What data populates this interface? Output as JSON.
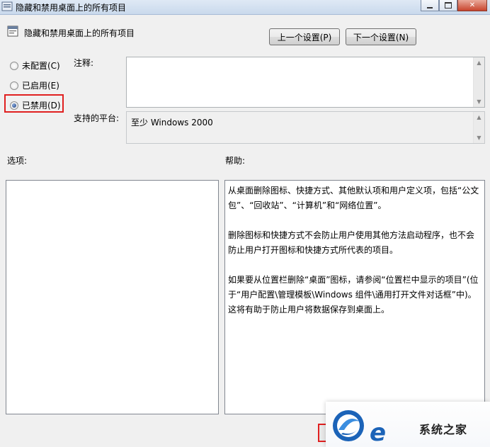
{
  "window": {
    "title": "隐藏和禁用桌面上的所有项目"
  },
  "header": {
    "policy_name": "隐藏和禁用桌面上的所有项目",
    "prev_button": "上一个设置(P)",
    "next_button": "下一个设置(N)"
  },
  "state": {
    "options": [
      {
        "label": "未配置(C)",
        "selected": false
      },
      {
        "label": "已启用(E)",
        "selected": false
      },
      {
        "label": "已禁用(D)",
        "selected": true
      }
    ]
  },
  "comment": {
    "label": "注释:",
    "value": ""
  },
  "platform": {
    "label": "支持的平台:",
    "value": "至少 Windows 2000"
  },
  "options_panel": {
    "label": "选项:"
  },
  "help_panel": {
    "label": "帮助:",
    "paragraphs": [
      "从桌面删除图标、快捷方式、其他默认项和用户定义项，包括“公文包”、“回收站”、“计算机”和“网络位置”。",
      "删除图标和快捷方式不会防止用户使用其他方法启动程序，也不会防止用户打开图标和快捷方式所代表的项目。",
      "如果要从位置栏删除“桌面”图标，请参阅“位置栏中显示的项目”(位于“用户配置\\管理模板\\Windows 组件\\通用打开文件对话框”中)。这将有助于防止用户将数据保存到桌面上。"
    ]
  },
  "watermark": {
    "text": "系统之家"
  },
  "colors": {
    "highlight": "#e02020",
    "window_bg": "#f0f0f0",
    "brand_blue": "#1b63b8"
  }
}
